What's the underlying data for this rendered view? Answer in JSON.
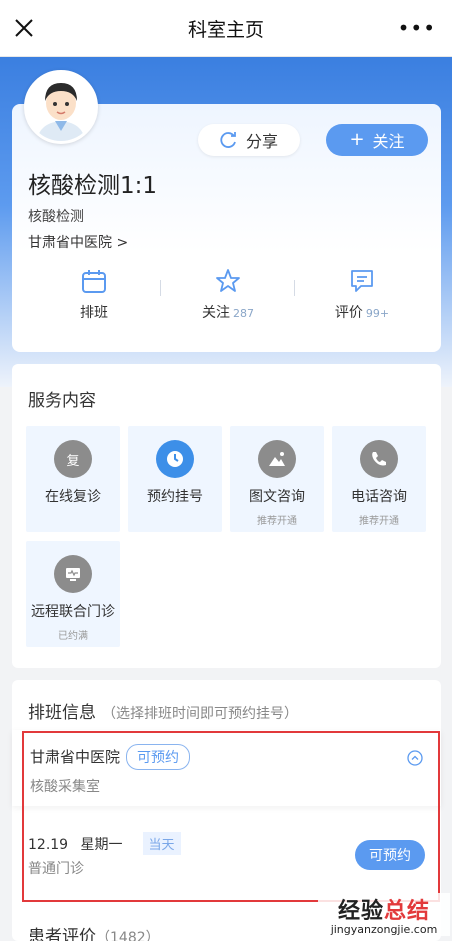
{
  "topbar": {
    "title": "科室主页",
    "more": "•••"
  },
  "doctor": {
    "name": "核酸检测1:1",
    "department": "核酸检测",
    "hospital": "甘肃省中医院 >"
  },
  "actions": {
    "share_label": "分享",
    "follow_label": "关注"
  },
  "stats": [
    {
      "label": "排班",
      "count": ""
    },
    {
      "label": "关注",
      "count": "287"
    },
    {
      "label": "评价",
      "count": "99+"
    }
  ],
  "services": {
    "title": "服务内容",
    "items": [
      {
        "label": "在线复诊",
        "sub": ""
      },
      {
        "label": "预约挂号",
        "sub": ""
      },
      {
        "label": "图文咨询",
        "sub": "推荐开通"
      },
      {
        "label": "电话咨询",
        "sub": "推荐开通"
      },
      {
        "label": "远程联合门诊",
        "sub": "已约满"
      }
    ],
    "icon_glyph_review": "复"
  },
  "schedule": {
    "title": "排班信息",
    "hint": "（选择排班时间即可预约挂号）",
    "hospital": "甘肃省中医院",
    "status": "可预约",
    "room": "核酸采集室",
    "date": "12.19",
    "weekday": "星期一",
    "today": "当天",
    "clinic": "普通门诊",
    "book_label": "可预约"
  },
  "reviews": {
    "title": "患者评价",
    "count": "（1482）"
  },
  "watermark": {
    "cn_black": "经验",
    "cn_red": "总结",
    "en": "jingyanzongjie.com"
  },
  "colors": {
    "primary": "#5b9af0",
    "highlight": "#e2393b",
    "icon_gray": "#8c8c8c",
    "icon_blue": "#3d8fe8"
  }
}
